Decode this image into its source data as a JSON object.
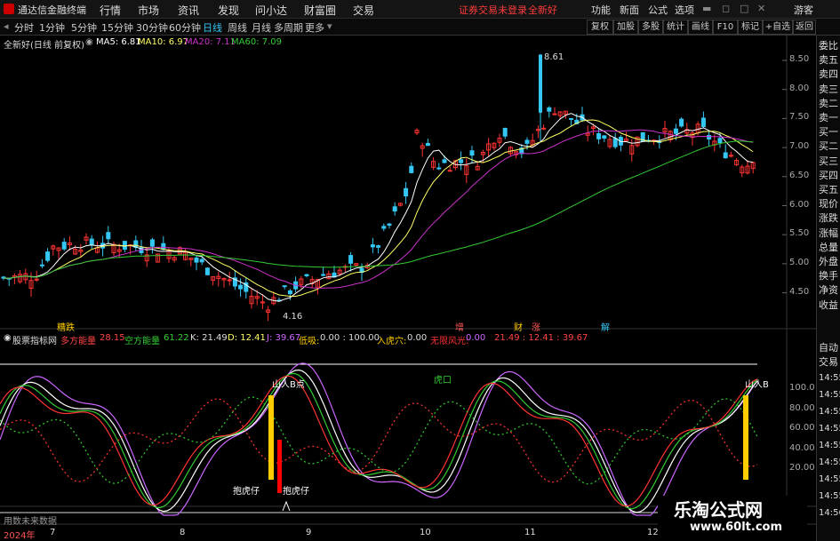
{
  "app": {
    "title": "通达信金融终端"
  },
  "menu": [
    "行情",
    "市场",
    "资讯",
    "发现",
    "问小达",
    "财富圈",
    "交易"
  ],
  "promo": "证券交易未登录",
  "promo2": "全新好",
  "top_right": [
    "功能",
    "新面",
    "公式",
    "选项"
  ],
  "guest": "游客",
  "toolbar": {
    "periods": [
      "分时",
      "1分钟",
      "5分钟",
      "15分钟",
      "30分钟",
      "60分钟",
      "日线",
      "周线",
      "月线",
      "多周期",
      "更多"
    ],
    "selected": "日线",
    "buttons": [
      "复权",
      "加股",
      "多股",
      "统计",
      "画线",
      "F10",
      "标记",
      "+自选",
      "返回"
    ]
  },
  "legend_main": {
    "stock": "全新好(日线 前复权)",
    "ma5": "MA5: 6.81",
    "ma10": "MA10: 6.97",
    "ma20": "MA20: 7.11",
    "ma60": "MA60: 7.09"
  },
  "colors": {
    "ma5": "#ffffff",
    "ma10": "#ffff66",
    "ma20": "#cc33cc",
    "ma60": "#33cc33",
    "up": "#ff3333",
    "down": "#35c7f4"
  },
  "price_axis": [
    "8.50",
    "8.00",
    "7.50",
    "7.00",
    "6.50",
    "6.00",
    "5.50",
    "5.00",
    "4.50"
  ],
  "price_marks": {
    "high": "8.61",
    "low": "4.16"
  },
  "events": [
    "糟跌",
    "增",
    "财",
    "涨",
    "解"
  ],
  "indicator": {
    "name": "股票指标网",
    "duo_label": "多方能量",
    "duo_value": "28.15",
    "kong_label": "空方能量",
    "kong_value": "61.22",
    "k": "K: 21.49",
    "d": "D: 12.41",
    "j": "J: 39.67",
    "low_label": "低吸:",
    "low_value": "0.00 : 100.00",
    "tiger_label": "入虎穴:",
    "tiger_value": "0.00",
    "risk_label": "无限风光:",
    "risk_value": "0.00",
    "tail": "21.49 : 12.41 : 39.67"
  },
  "ind_axis": [
    "100.0",
    "80.00",
    "60.00",
    "40.00",
    "20.00"
  ],
  "annotations": {
    "mountain_b": "山人B点",
    "mountain_b2": "山人B",
    "tiger1": "抱虎仔",
    "tiger2": "抱虎仔",
    "tiger_mouth": "虎口"
  },
  "footer": {
    "note": "用数未来数据",
    "year": "2024年",
    "months": [
      "7",
      "8",
      "9",
      "10",
      "11",
      "12"
    ]
  },
  "sidebar": [
    "委比",
    "卖五",
    "卖四",
    "卖三",
    "卖二",
    "卖一",
    "买一",
    "买二",
    "买三",
    "买四",
    "买五",
    "现价",
    "涨跌",
    "涨幅",
    "总量",
    "外盘",
    "换手",
    "净资",
    "收益"
  ],
  "sidebar_lower": [
    "自动",
    "交易"
  ],
  "sidebar_times": [
    "14:55",
    "14:55",
    "14:55",
    "14:55",
    "14:55",
    "14:55",
    "14:55",
    "14:55",
    "14:56"
  ],
  "watermark": {
    "cn": "乐淘公式网",
    "url": "www.60lt.com"
  }
}
